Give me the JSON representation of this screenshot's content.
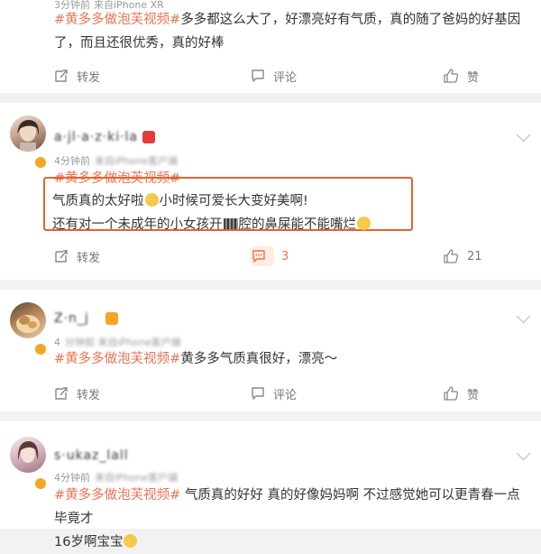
{
  "actions": {
    "repost_label": "转发",
    "comment_label": "评论",
    "like_label": "赞"
  },
  "posts": [
    {
      "meta_visible": "3分钟前",
      "meta_rest": "来自iPhone XR",
      "tag": "#黄多多做泡芙视频#",
      "text": "多多都这么大了，好漂亮好有气质，真的随了爸妈的好基因了，而且还很优秀，真的好棒"
    },
    {
      "name": "a·jl·a·z·ki·la",
      "meta_visible": "4分钟前",
      "meta_rest": "来自iPhone客户端",
      "tag": "#黄多多做泡芙视频#",
      "line1_a": "气质真的太好啦",
      "line1_b": "小时候可爱长大变好美啊!",
      "line2_a": "还有对一个未成年的小女孩开",
      "line2_b": "腔的鼻屎能不能嘴烂",
      "comment_count": "3",
      "like_count": "21"
    },
    {
      "name": "Z·n_j",
      "meta_visible": "4",
      "meta_rest": "分钟前 来自iPhone客户端",
      "tag": "#黄多多做泡芙视频#",
      "text": "黄多多气质真很好，漂亮～"
    },
    {
      "name": "s·ukaz_lall",
      "meta_visible": "4分钟前",
      "meta_rest": "来自iPhone客户端",
      "tag": "#黄多多做泡芙视频#",
      "text_line1": " 气质真的好好 真的好像妈妈啊 不过感觉她可以更青春一点毕竟才",
      "text_line2": "16岁啊宝宝"
    }
  ]
}
